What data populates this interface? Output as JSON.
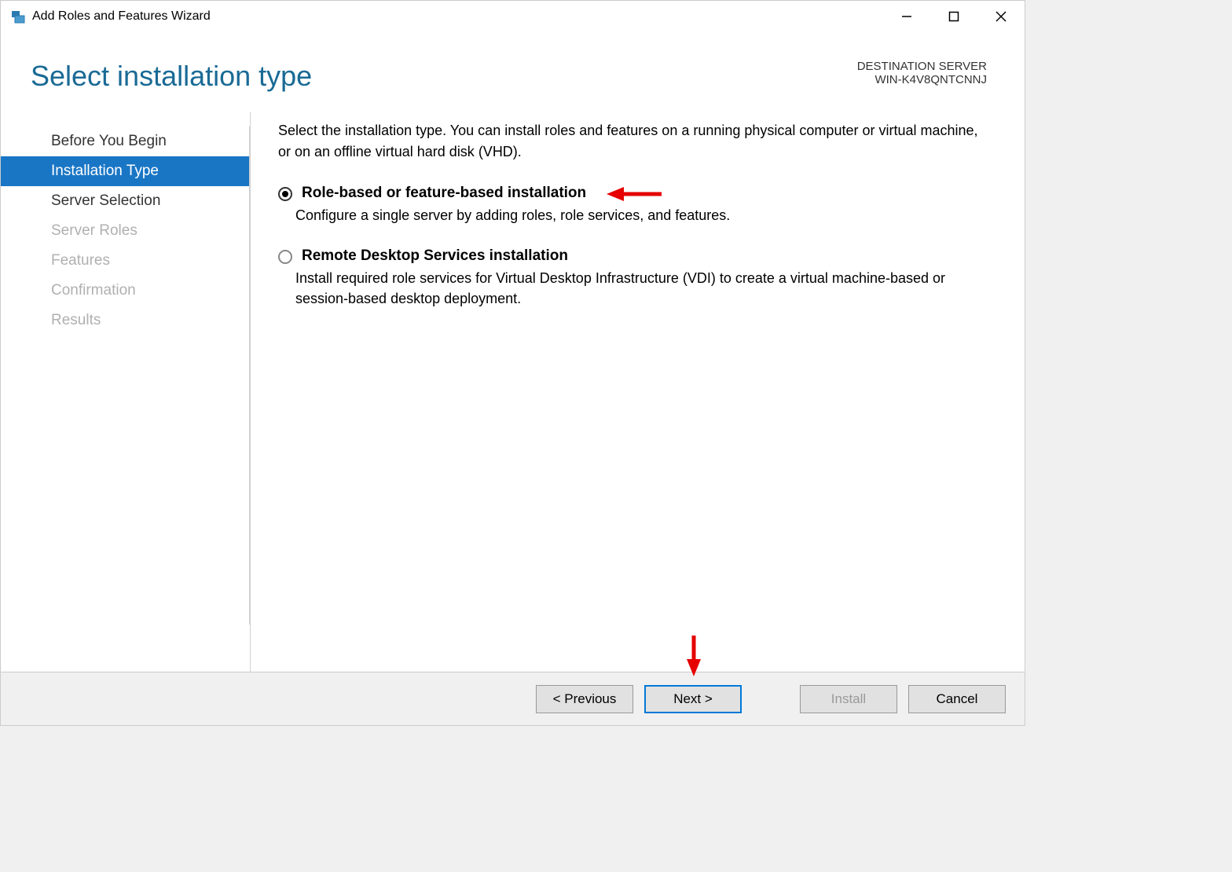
{
  "window": {
    "title": "Add Roles and Features Wizard"
  },
  "header": {
    "page_title": "Select installation type",
    "destination_label": "DESTINATION SERVER",
    "destination_server": "WIN-K4V8QNTCNNJ"
  },
  "sidebar": {
    "items": [
      {
        "label": "Before You Begin",
        "state": "normal"
      },
      {
        "label": "Installation Type",
        "state": "active"
      },
      {
        "label": "Server Selection",
        "state": "normal"
      },
      {
        "label": "Server Roles",
        "state": "disabled"
      },
      {
        "label": "Features",
        "state": "disabled"
      },
      {
        "label": "Confirmation",
        "state": "disabled"
      },
      {
        "label": "Results",
        "state": "disabled"
      }
    ]
  },
  "content": {
    "intro": "Select the installation type. You can install roles and features on a running physical computer or virtual machine, or on an offline virtual hard disk (VHD).",
    "options": [
      {
        "title": "Role-based or feature-based installation",
        "desc": "Configure a single server by adding roles, role services, and features.",
        "selected": true
      },
      {
        "title": "Remote Desktop Services installation",
        "desc": "Install required role services for Virtual Desktop Infrastructure (VDI) to create a virtual machine-based or session-based desktop deployment.",
        "selected": false
      }
    ]
  },
  "buttons": {
    "previous": "< Previous",
    "next": "Next >",
    "install": "Install",
    "cancel": "Cancel"
  },
  "annotations": {
    "arrow_color": "#e60000"
  }
}
